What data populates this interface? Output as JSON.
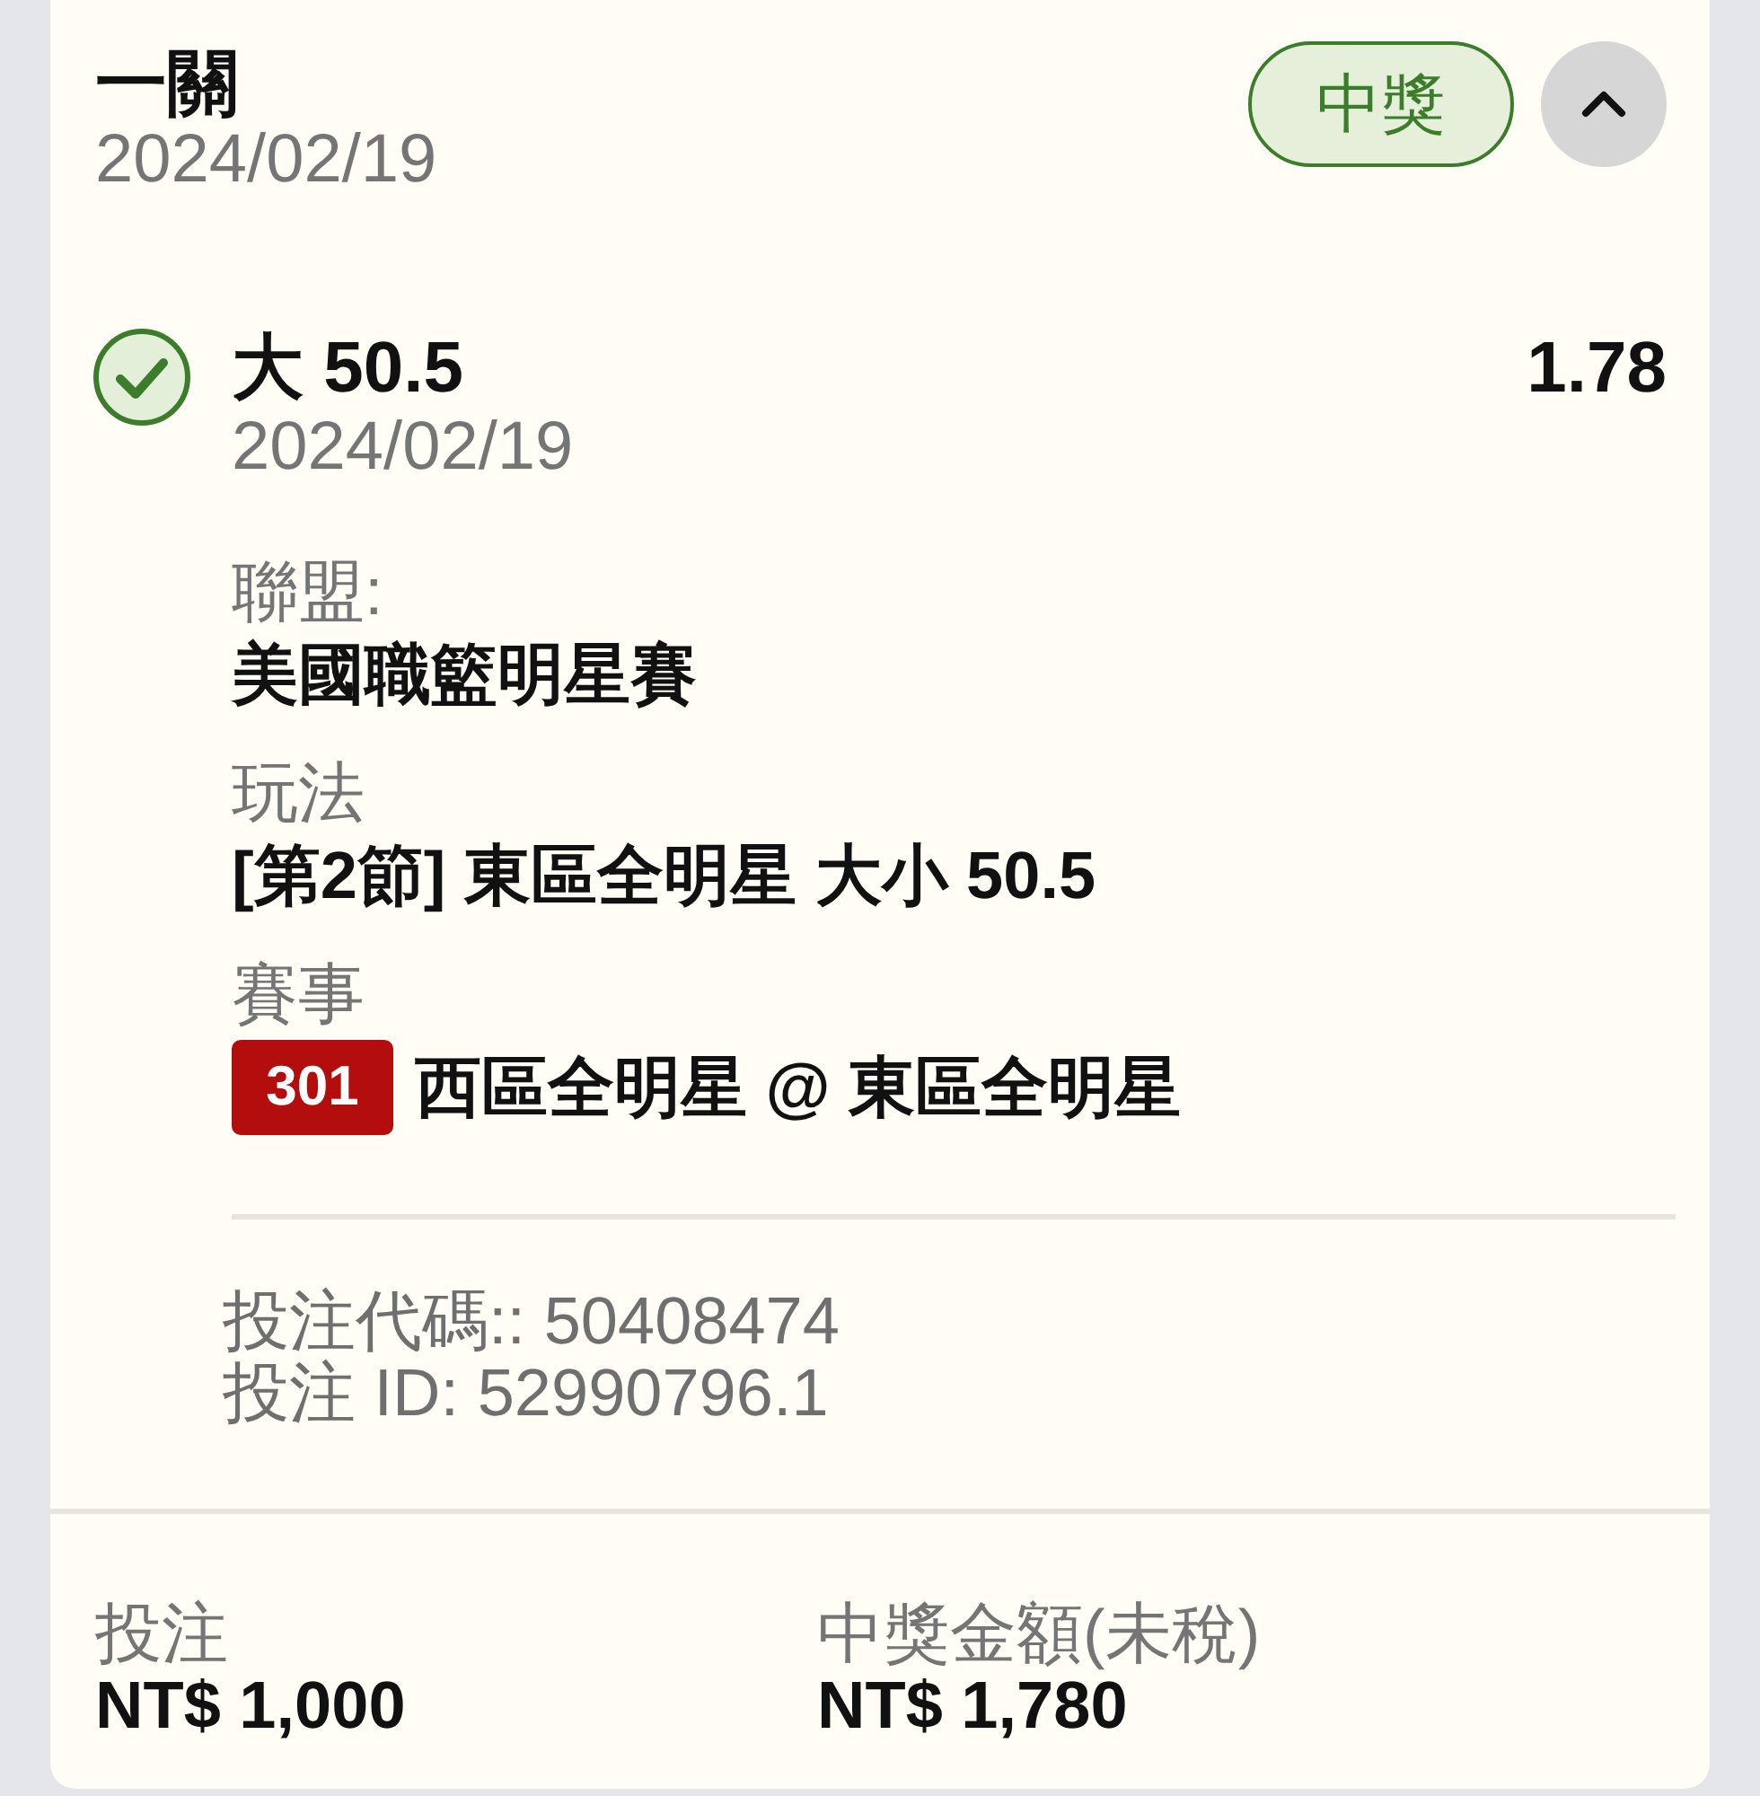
{
  "header": {
    "title": "一關",
    "date": "2024/02/19",
    "status_badge": "中獎",
    "expanded": true
  },
  "selection": {
    "won": true,
    "pick": "大 50.5",
    "date": "2024/02/19",
    "odds": "1.78",
    "details": [
      {
        "label": "聯盟:",
        "value": "美國職籃明星賽"
      },
      {
        "label": "玩法",
        "value": "[第2節] 東區全明星 大小 50.5"
      },
      {
        "label": "賽事",
        "event_number": "301",
        "value": "西區全明星 @ 東區全明星"
      }
    ]
  },
  "references": [
    "投注代碼:: 50408474",
    "投注 ID: 52990796.1"
  ],
  "summary": [
    {
      "label": "投注",
      "amount": "NT$ 1,000"
    },
    {
      "label": "中獎金額(未稅)",
      "amount": "NT$ 1,780"
    }
  ]
}
